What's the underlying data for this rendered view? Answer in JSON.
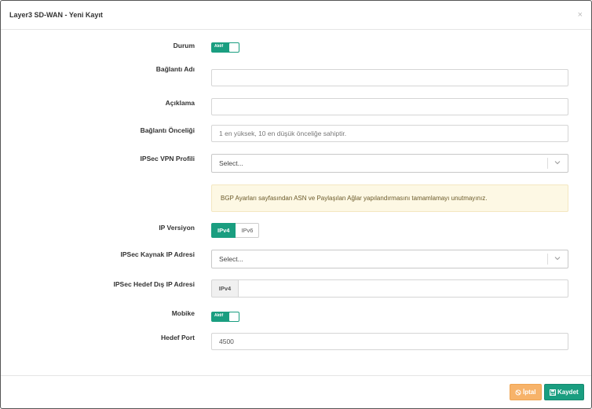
{
  "modal": {
    "title": "Layer3 SD-WAN - Yeni Kayıt",
    "close_glyph": "×"
  },
  "form": {
    "status": {
      "label": "Durum",
      "toggle_text": "Aktif",
      "checked": true
    },
    "connection_name": {
      "label": "Bağlantı Adı",
      "value": ""
    },
    "description": {
      "label": "Açıklama",
      "value": ""
    },
    "priority": {
      "label": "Bağlantı Önceliği",
      "placeholder": "1 en yüksek, 10 en düşük önceliğe sahiptir."
    },
    "ipsec_profile": {
      "label": "IPSec VPN Profili",
      "selected": "Select..."
    },
    "bgp_notice": "BGP Ayarları sayfasından ASN ve Paylaşılan Ağlar yapılandırmasını tamamlamayı unutmayınız.",
    "ip_version": {
      "label": "IP Versiyon",
      "options": [
        "IPv4",
        "IPv6"
      ],
      "selected": "IPv4"
    },
    "source_ip": {
      "label": "IPSec Kaynak IP Adresi",
      "selected": "Select..."
    },
    "dest_ip": {
      "label": "IPSec Hedef Dış IP Adresi",
      "addon": "IPv4",
      "value": ""
    },
    "mobike": {
      "label": "Mobike",
      "toggle_text": "Aktif",
      "checked": true
    },
    "dest_port": {
      "label": "Hedef Port",
      "value": "4500"
    }
  },
  "footer": {
    "cancel_label": "İptal",
    "save_label": "Kaydet"
  },
  "colors": {
    "accent": "#1a9e80",
    "cancel": "#f7b36a",
    "notice_bg": "#fdf8e4"
  },
  "icons": {
    "close": "close-icon",
    "chevron": "chevron-down-icon",
    "cancel": "ban-icon",
    "save": "floppy-disk-icon"
  }
}
